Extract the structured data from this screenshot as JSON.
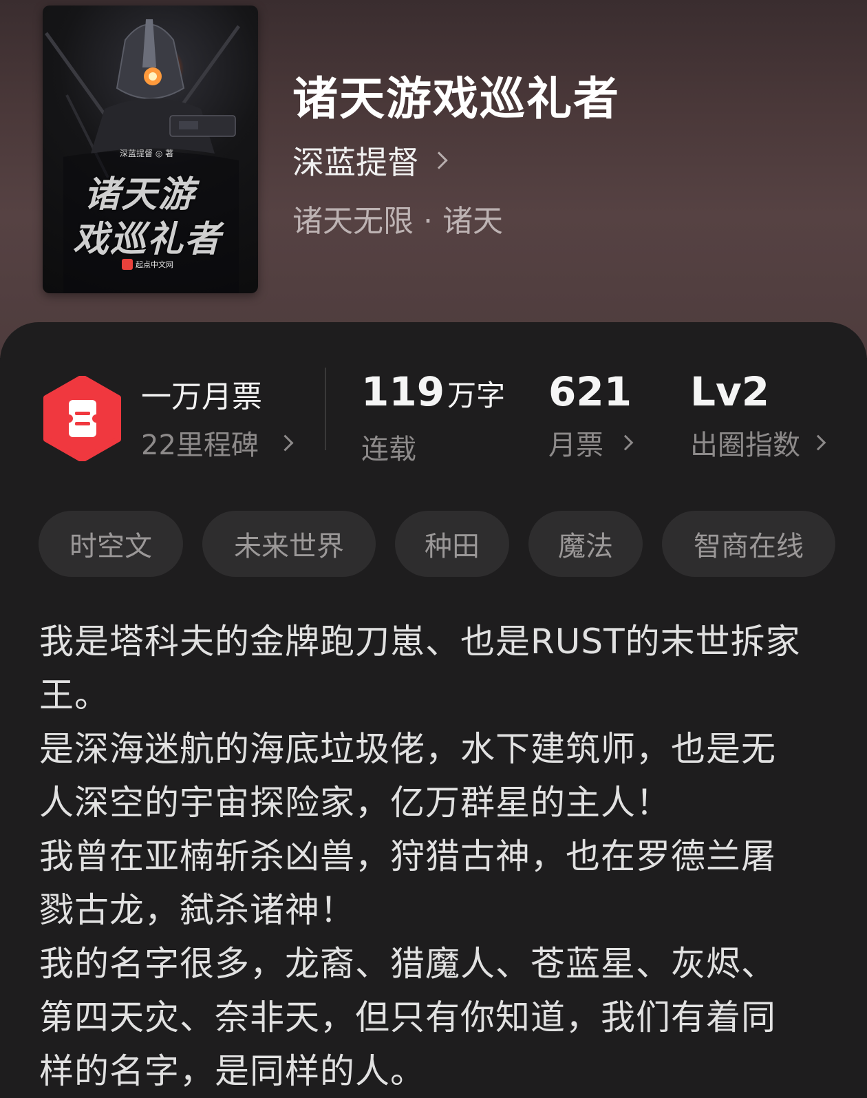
{
  "book": {
    "title": "诸天游戏巡礼者",
    "author": "深蓝提督",
    "genre": "诸天无限 · 诸天"
  },
  "cover": {
    "title_line1": "诸天游",
    "title_line2": "戏巡礼者",
    "author_text": "深蓝提督 ◎ 著",
    "publisher": "起点中文网"
  },
  "milestone": {
    "title": "一万月票",
    "subtitle": "22里程碑",
    "badge_color": "#f0383f",
    "icon": "ticket-icon"
  },
  "stats": {
    "words_number": "119",
    "words_unit": "万字",
    "words_label": "连载",
    "tickets_number": "621",
    "tickets_label": "月票",
    "level_number": "Lv2",
    "level_label": "出圈指数"
  },
  "tags": [
    "时空文",
    "未来世界",
    "种田",
    "魔法",
    "智商在线"
  ],
  "description": [
    "我是塔科夫的金牌跑刀崽、也是RUST的末世拆家",
    "王。",
    "是深海迷航的海底垃圾佬，水下建筑师，也是无",
    "人深空的宇宙探险家，亿万群星的主人！",
    "我曾在亚楠斩杀凶兽，狩猎古神，也在罗德兰屠",
    "戮古龙，弑杀诸神！",
    "我的名字很多，龙裔、猎魔人、苍蓝星、灰烬、",
    "第四天灾、奈非天，但只有你知道，我们有着同",
    "样的名字，是同样的人。"
  ]
}
